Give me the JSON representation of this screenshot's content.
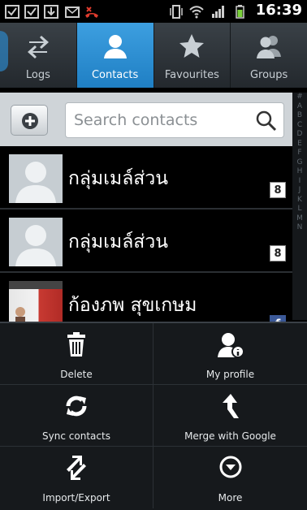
{
  "status_bar": {
    "time": "16:39"
  },
  "tabs": [
    {
      "label": "Logs",
      "active": false
    },
    {
      "label": "Contacts",
      "active": true
    },
    {
      "label": "Favourites",
      "active": false
    },
    {
      "label": "Groups",
      "active": false
    }
  ],
  "search": {
    "placeholder": "Search contacts"
  },
  "index": [
    "#",
    "A",
    "B",
    "C",
    "D",
    "E",
    "F",
    "G",
    "H",
    "I",
    "J",
    "K",
    "L",
    "M",
    "N"
  ],
  "contacts": [
    {
      "name": "กลุ่มเมล์ส่วน",
      "account": "google"
    },
    {
      "name": "กลุ่มเมล์ส่วน",
      "account": "google"
    },
    {
      "name": "ก้องภพ สุขเกษม",
      "account": "facebook"
    }
  ],
  "badges": {
    "google": "8",
    "facebook": "f"
  },
  "menu": {
    "delete": "Delete",
    "my_profile": "My profile",
    "sync": "Sync contacts",
    "merge": "Merge with Google",
    "import_export": "Import/Export",
    "more": "More"
  },
  "colors": {
    "active_tab": "#2b8fd6",
    "tab_bar": "#2d3338",
    "menu_bg": "#16191c"
  }
}
